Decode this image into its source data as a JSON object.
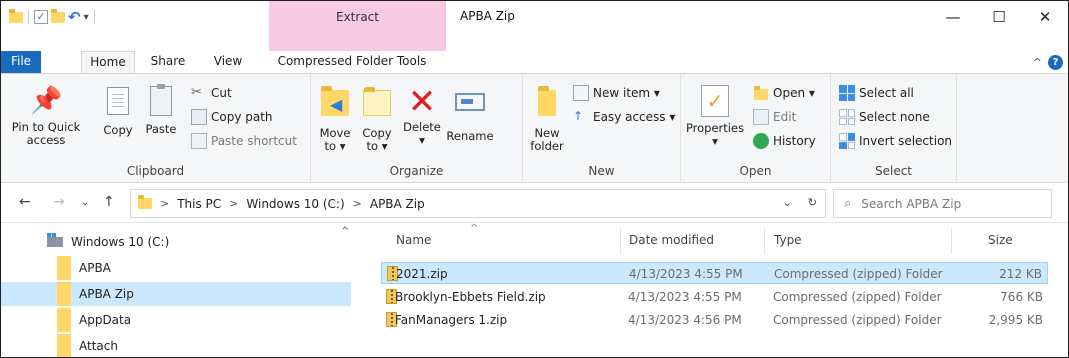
{
  "window": {
    "context_tab": "Extract",
    "title": "APBA Zip",
    "minimize": "—",
    "maximize": "☐",
    "close": "✕"
  },
  "tabs": {
    "file": "File",
    "home": "Home",
    "share": "Share",
    "view": "View",
    "compressed": "Compressed Folder Tools",
    "help": "?"
  },
  "ribbon": {
    "clipboard": {
      "label": "Clipboard",
      "pin_line1": "Pin to Quick",
      "pin_line2": "access",
      "copy": "Copy",
      "paste": "Paste",
      "cut": "Cut",
      "copy_path": "Copy path",
      "paste_shortcut": "Paste shortcut"
    },
    "organize": {
      "label": "Organize",
      "move_line1": "Move",
      "move_line2": "to ▾",
      "copy_line1": "Copy",
      "copy_line2": "to ▾",
      "delete_line1": "Delete",
      "delete_line2": "▾",
      "rename": "Rename"
    },
    "new": {
      "label": "New",
      "folder_line1": "New",
      "folder_line2": "folder",
      "new_item": "New item ▾",
      "easy_access": "Easy access ▾"
    },
    "open": {
      "label": "Open",
      "properties_line1": "Properties",
      "properties_line2": "▾",
      "open": "Open ▾",
      "edit": "Edit",
      "history": "History"
    },
    "select": {
      "label": "Select",
      "select_all": "Select all",
      "select_none": "Select none",
      "invert": "Invert selection"
    }
  },
  "address": {
    "crumbs": [
      "This PC",
      "Windows 10 (C:)",
      "APBA Zip"
    ],
    "search_placeholder": "Search APBA Zip"
  },
  "nav": {
    "items": [
      {
        "label": "Windows 10 (C:)",
        "type": "drive",
        "selected": false
      },
      {
        "label": "APBA",
        "type": "folder",
        "selected": false
      },
      {
        "label": "APBA Zip",
        "type": "folder",
        "selected": true
      },
      {
        "label": "AppData",
        "type": "folder",
        "selected": false
      },
      {
        "label": "Attach",
        "type": "folder",
        "selected": false
      }
    ]
  },
  "files": {
    "headers": {
      "name": "Name",
      "date": "Date modified",
      "type": "Type",
      "size": "Size"
    },
    "rows": [
      {
        "name": "2021.zip",
        "date": "4/13/2023 4:55 PM",
        "type": "Compressed (zipped) Folder",
        "size": "212 KB",
        "selected": true
      },
      {
        "name": "Brooklyn-Ebbets Field.zip",
        "date": "4/13/2023 4:55 PM",
        "type": "Compressed (zipped) Folder",
        "size": "766 KB",
        "selected": false
      },
      {
        "name": "FanManagers 1.zip",
        "date": "4/13/2023 4:56 PM",
        "type": "Compressed (zipped) Folder",
        "size": "2,995 KB",
        "selected": false
      }
    ]
  },
  "colors": {
    "accent": "#1a6bbf",
    "selection": "#cce8ff",
    "context_tab": "#f7c9e5",
    "folder": "#ffd766"
  }
}
